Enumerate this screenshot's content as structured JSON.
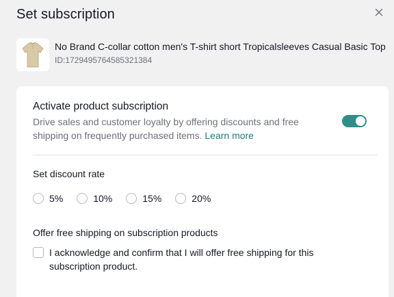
{
  "modal": {
    "title": "Set subscription",
    "close_icon": "close-icon"
  },
  "product": {
    "name": "No Brand C-collar cotton men's T-shirt short Tropicalsleeves Casual Basic Top",
    "id_text": "ID:1729495764585321384",
    "thumbnail_icon": "tshirt-image"
  },
  "subscription": {
    "title": "Activate product subscription",
    "description": "Drive sales and customer loyalty by offering discounts and free shipping on frequently purchased items.",
    "learn_more": "Learn more",
    "enabled": true
  },
  "discount": {
    "label": "Set discount rate",
    "options": [
      "5%",
      "10%",
      "15%",
      "20%"
    ],
    "selected": null
  },
  "shipping": {
    "label": "Offer free shipping on subscription products",
    "acknowledge_text": "I acknowledge and confirm that I will offer free shipping for this subscription product.",
    "checked": false
  },
  "colors": {
    "accent": "#2f8f88",
    "link": "#1f7f7a",
    "background": "#f1f1f2"
  }
}
